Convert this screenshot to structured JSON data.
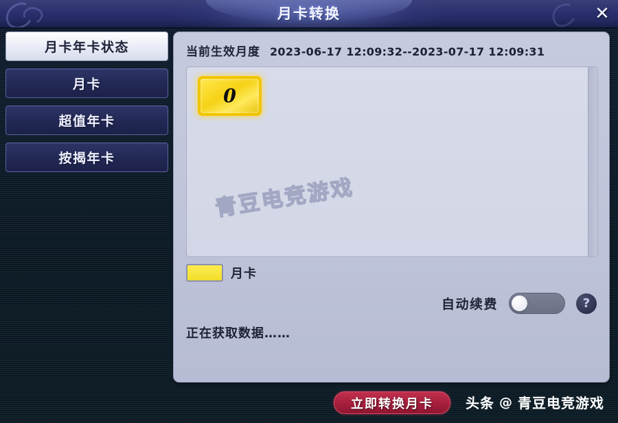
{
  "window": {
    "title": "月卡转换",
    "close_icon": "close-icon",
    "close_label": "✕"
  },
  "sidebar": {
    "items": [
      {
        "label": "月卡年卡状态",
        "active": true
      },
      {
        "label": "月卡",
        "active": false
      },
      {
        "label": "超值年卡",
        "active": false
      },
      {
        "label": "按揭年卡",
        "active": false
      }
    ]
  },
  "main": {
    "period": {
      "label": "当前生效月度",
      "value": "2023-06-17 12:09:32--2023-07-17 12:09:31"
    },
    "card_list": {
      "items": [
        {
          "count": "0",
          "type": "月卡",
          "color": "#f2d216"
        }
      ],
      "watermark": "青豆电竞游戏"
    },
    "legend": {
      "swatch_color": "#f2dd2c",
      "label": "月卡"
    },
    "auto_renew": {
      "label": "自动续费",
      "enabled": false,
      "help_icon": "question-mark-icon",
      "help_label": "?"
    },
    "status_text": "正在获取数据……"
  },
  "footer": {
    "convert_button": "立即转换月卡",
    "brand_prefix": "头条",
    "brand_at": "@",
    "brand_name": "青豆电竞游戏"
  },
  "colors": {
    "accent_red": "#a8203e",
    "card_yellow": "#f2d216",
    "panel_bg": "#bfc4da",
    "titlebar_blue": "#2d3170",
    "background_navy": "#102030"
  }
}
